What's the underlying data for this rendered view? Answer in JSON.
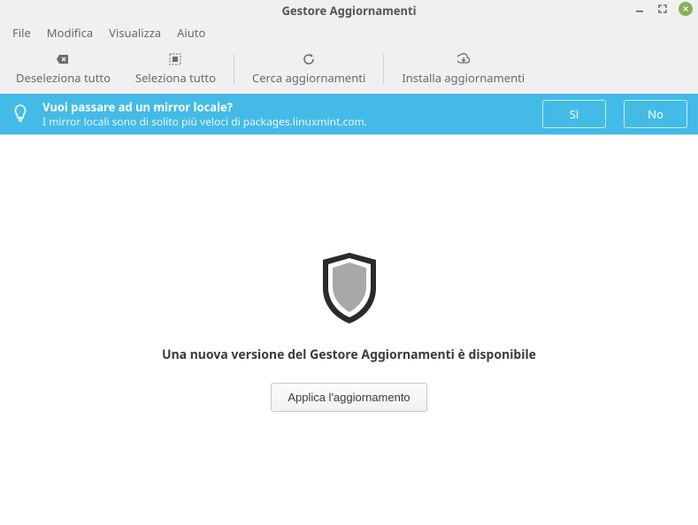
{
  "window": {
    "title": "Gestore Aggiornamenti"
  },
  "menubar": {
    "file": "File",
    "edit": "Modifica",
    "view": "Visualizza",
    "help": "Aiuto"
  },
  "toolbar": {
    "deselect_all": "Deseleziona tutto",
    "select_all": "Seleziona tutto",
    "check_updates": "Cerca aggiornamenti",
    "install_updates": "Installa aggiornamenti"
  },
  "banner": {
    "headline": "Vuoi passare ad un mirror locale?",
    "subtext": "I mirror locali sono di solito più veloci di packages.linuxmint.com.",
    "yes": "Sì",
    "no": "No"
  },
  "main": {
    "message": "Una nuova versione del Gestore Aggiornamenti è disponibile",
    "apply_button": "Applica l'aggiornamento"
  },
  "colors": {
    "accent": "#43bbe6",
    "close_button": "#87b158"
  }
}
